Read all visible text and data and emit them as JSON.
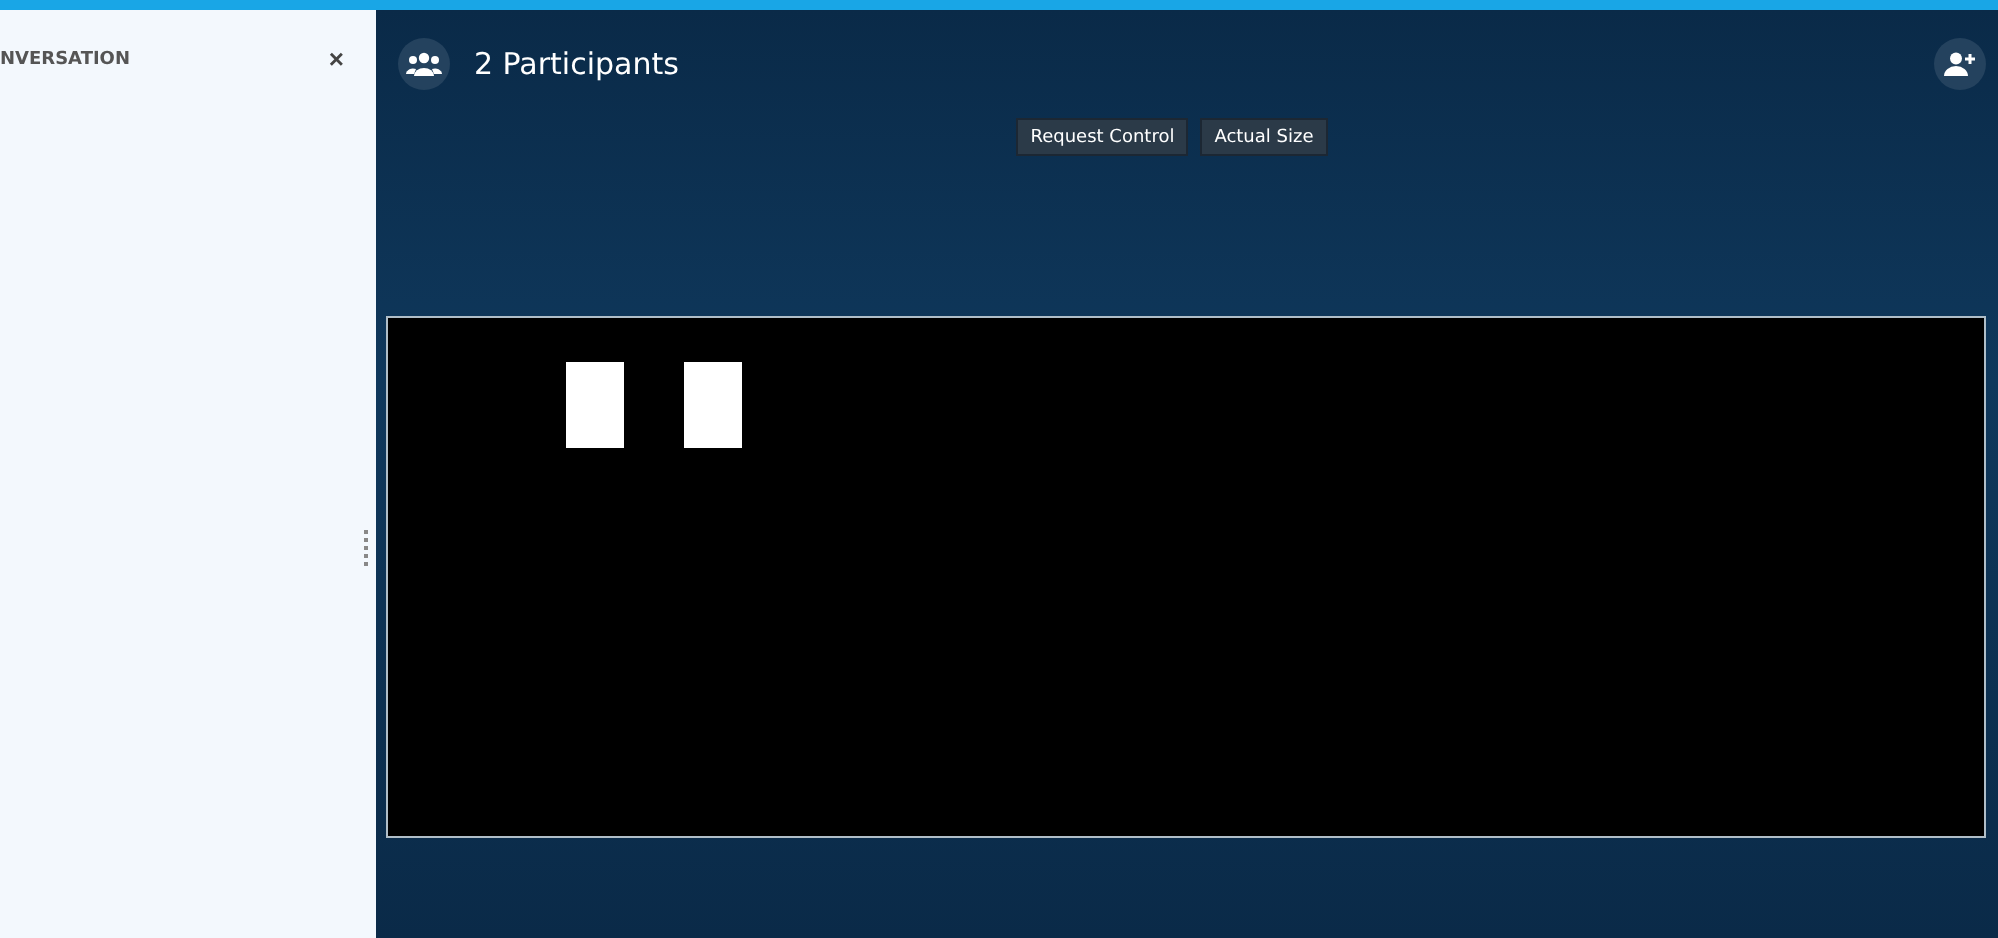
{
  "conversation_panel": {
    "title": "NVERSATION",
    "close": "×"
  },
  "header": {
    "title": "2 Participants"
  },
  "buttons": [
    {
      "label": "Request Control"
    },
    {
      "label": "Actual Size"
    }
  ],
  "shared_screen": {
    "kind": "screen-share"
  }
}
